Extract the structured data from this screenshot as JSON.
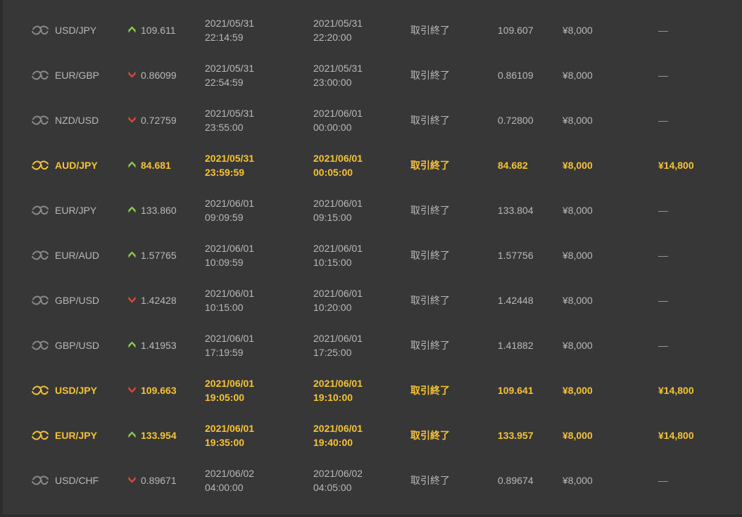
{
  "colors": {
    "background": "#373737",
    "text": "#b9b9b9",
    "win_text": "#f5c335",
    "up_arrow": "#8fd14f",
    "down_arrow": "#e0493a",
    "icon_muted": "#8a8a8a"
  },
  "trades": [
    {
      "pair": "USD/JPY",
      "direction": "up",
      "entry_rate": "109.611",
      "start_date": "2021/05/31",
      "start_time": "22:14:59",
      "end_date": "2021/05/31",
      "end_time": "22:20:00",
      "status": "取引終了",
      "close_rate": "109.607",
      "amount": "¥8,000",
      "payout": "—",
      "win": false
    },
    {
      "pair": "EUR/GBP",
      "direction": "down",
      "entry_rate": "0.86099",
      "start_date": "2021/05/31",
      "start_time": "22:54:59",
      "end_date": "2021/05/31",
      "end_time": "23:00:00",
      "status": "取引終了",
      "close_rate": "0.86109",
      "amount": "¥8,000",
      "payout": "—",
      "win": false
    },
    {
      "pair": "NZD/USD",
      "direction": "down",
      "entry_rate": "0.72759",
      "start_date": "2021/05/31",
      "start_time": "23:55:00",
      "end_date": "2021/06/01",
      "end_time": "00:00:00",
      "status": "取引終了",
      "close_rate": "0.72800",
      "amount": "¥8,000",
      "payout": "—",
      "win": false
    },
    {
      "pair": "AUD/JPY",
      "direction": "up",
      "entry_rate": "84.681",
      "start_date": "2021/05/31",
      "start_time": "23:59:59",
      "end_date": "2021/06/01",
      "end_time": "00:05:00",
      "status": "取引終了",
      "close_rate": "84.682",
      "amount": "¥8,000",
      "payout": "¥14,800",
      "win": true
    },
    {
      "pair": "EUR/JPY",
      "direction": "up",
      "entry_rate": "133.860",
      "start_date": "2021/06/01",
      "start_time": "09:09:59",
      "end_date": "2021/06/01",
      "end_time": "09:15:00",
      "status": "取引終了",
      "close_rate": "133.804",
      "amount": "¥8,000",
      "payout": "—",
      "win": false
    },
    {
      "pair": "EUR/AUD",
      "direction": "up",
      "entry_rate": "1.57765",
      "start_date": "2021/06/01",
      "start_time": "10:09:59",
      "end_date": "2021/06/01",
      "end_time": "10:15:00",
      "status": "取引終了",
      "close_rate": "1.57756",
      "amount": "¥8,000",
      "payout": "—",
      "win": false
    },
    {
      "pair": "GBP/USD",
      "direction": "down",
      "entry_rate": "1.42428",
      "start_date": "2021/06/01",
      "start_time": "10:15:00",
      "end_date": "2021/06/01",
      "end_time": "10:20:00",
      "status": "取引終了",
      "close_rate": "1.42448",
      "amount": "¥8,000",
      "payout": "—",
      "win": false
    },
    {
      "pair": "GBP/USD",
      "direction": "up",
      "entry_rate": "1.41953",
      "start_date": "2021/06/01",
      "start_time": "17:19:59",
      "end_date": "2021/06/01",
      "end_time": "17:25:00",
      "status": "取引終了",
      "close_rate": "1.41882",
      "amount": "¥8,000",
      "payout": "—",
      "win": false
    },
    {
      "pair": "USD/JPY",
      "direction": "down",
      "entry_rate": "109.663",
      "start_date": "2021/06/01",
      "start_time": "19:05:00",
      "end_date": "2021/06/01",
      "end_time": "19:10:00",
      "status": "取引終了",
      "close_rate": "109.641",
      "amount": "¥8,000",
      "payout": "¥14,800",
      "win": true
    },
    {
      "pair": "EUR/JPY",
      "direction": "up",
      "entry_rate": "133.954",
      "start_date": "2021/06/01",
      "start_time": "19:35:00",
      "end_date": "2021/06/01",
      "end_time": "19:40:00",
      "status": "取引終了",
      "close_rate": "133.957",
      "amount": "¥8,000",
      "payout": "¥14,800",
      "win": true
    },
    {
      "pair": "USD/CHF",
      "direction": "down",
      "entry_rate": "0.89671",
      "start_date": "2021/06/02",
      "start_time": "04:00:00",
      "end_date": "2021/06/02",
      "end_time": "04:05:00",
      "status": "取引終了",
      "close_rate": "0.89674",
      "amount": "¥8,000",
      "payout": "—",
      "win": false
    }
  ]
}
